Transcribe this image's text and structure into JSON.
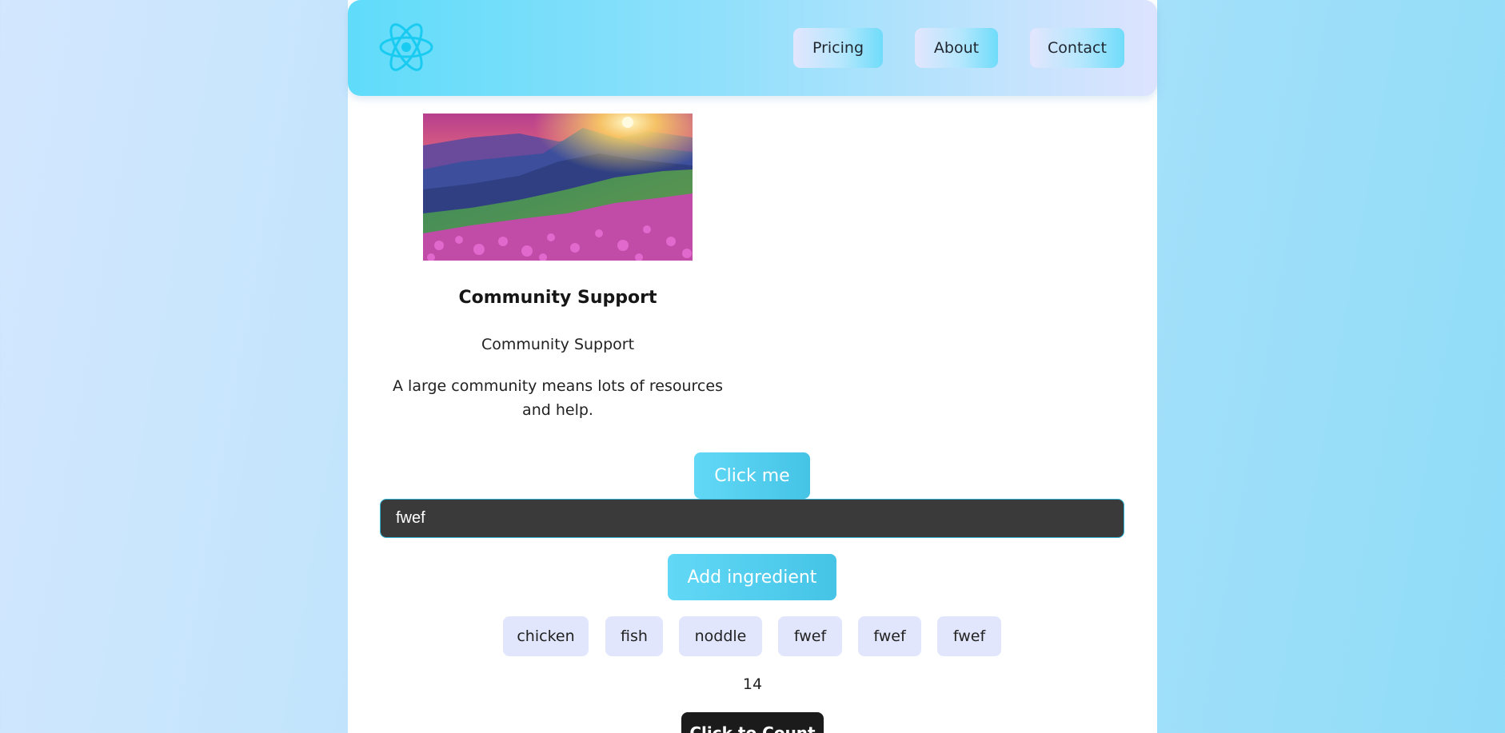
{
  "nav": {
    "items": [
      {
        "label": "Pricing"
      },
      {
        "label": "About"
      },
      {
        "label": "Contact"
      }
    ]
  },
  "card": {
    "image_icon": "mountain-sunset-photo",
    "title": "Community Support",
    "subtitle": "Community Support",
    "description": "A large community means lots of resources and help."
  },
  "click_button": {
    "label": "Click me"
  },
  "ingredient_input": {
    "value": "fwef"
  },
  "add_button": {
    "label": "Add ingredient"
  },
  "ingredients": [
    "chicken",
    "fish",
    "noddle",
    "fwef",
    "fwef",
    "fwef"
  ],
  "counter": {
    "value": "14"
  },
  "count_button": {
    "label": "Click to Count"
  },
  "colors": {
    "accent": "#62d8f6",
    "logo": "#19cbf0",
    "chip_bg": "#e1e6fc",
    "input_bg": "#3a3a3a"
  }
}
